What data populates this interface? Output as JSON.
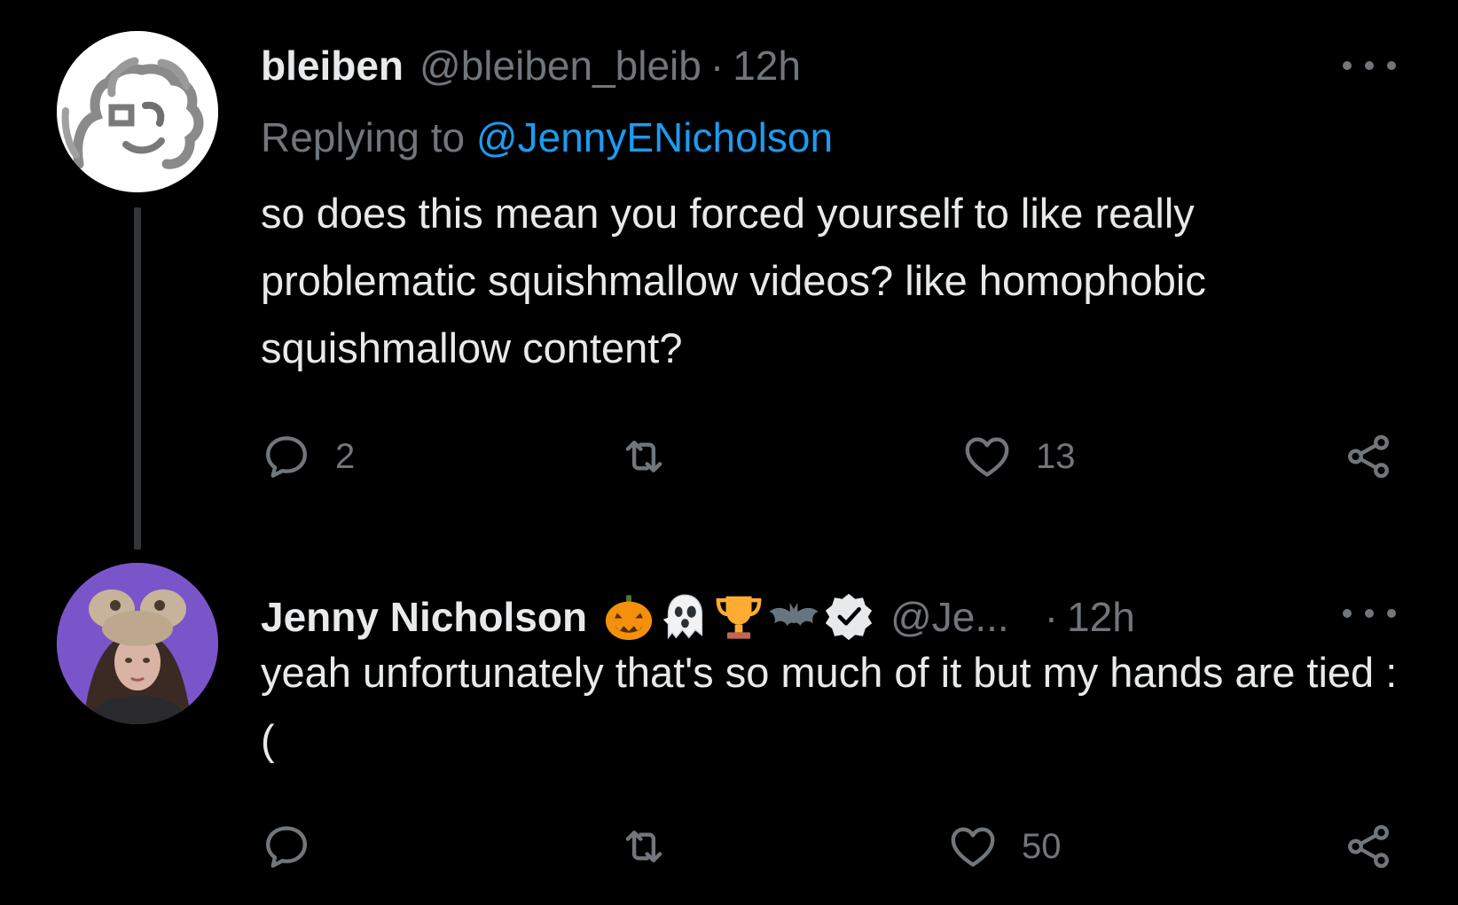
{
  "tweets": [
    {
      "display_name": "bleiben",
      "handle": "@bleiben_bleib",
      "separator": "·",
      "time": "12h",
      "replying_prefix": "Replying to",
      "replying_handle": "@JennyENicholson",
      "text": "so does this mean you forced yourself to like really problematic squishmallow videos? like homophobic squishmallow content?",
      "replies": "2",
      "retweets": "",
      "likes": "13",
      "avatar_icon": "drawn-face-avatar"
    },
    {
      "display_name": "Jenny Nicholson",
      "name_emojis": [
        "jack-o-lantern-icon",
        "ghost-icon",
        "trophy-icon",
        "bat-icon"
      ],
      "verified_icon": "verified-badge-icon",
      "handle": "@Je...",
      "separator": "·",
      "time": "12h",
      "text": "yeah unfortunately that's so much of it but my hands are tied :(",
      "replies": "",
      "retweets": "",
      "likes": "50",
      "avatar_icon": "photo-avatar"
    }
  ],
  "colors": {
    "background": "#000000",
    "primary_text": "#e7e9ea",
    "secondary_text": "#71767b",
    "link": "#1d9bf0",
    "thread_line": "#333639"
  }
}
